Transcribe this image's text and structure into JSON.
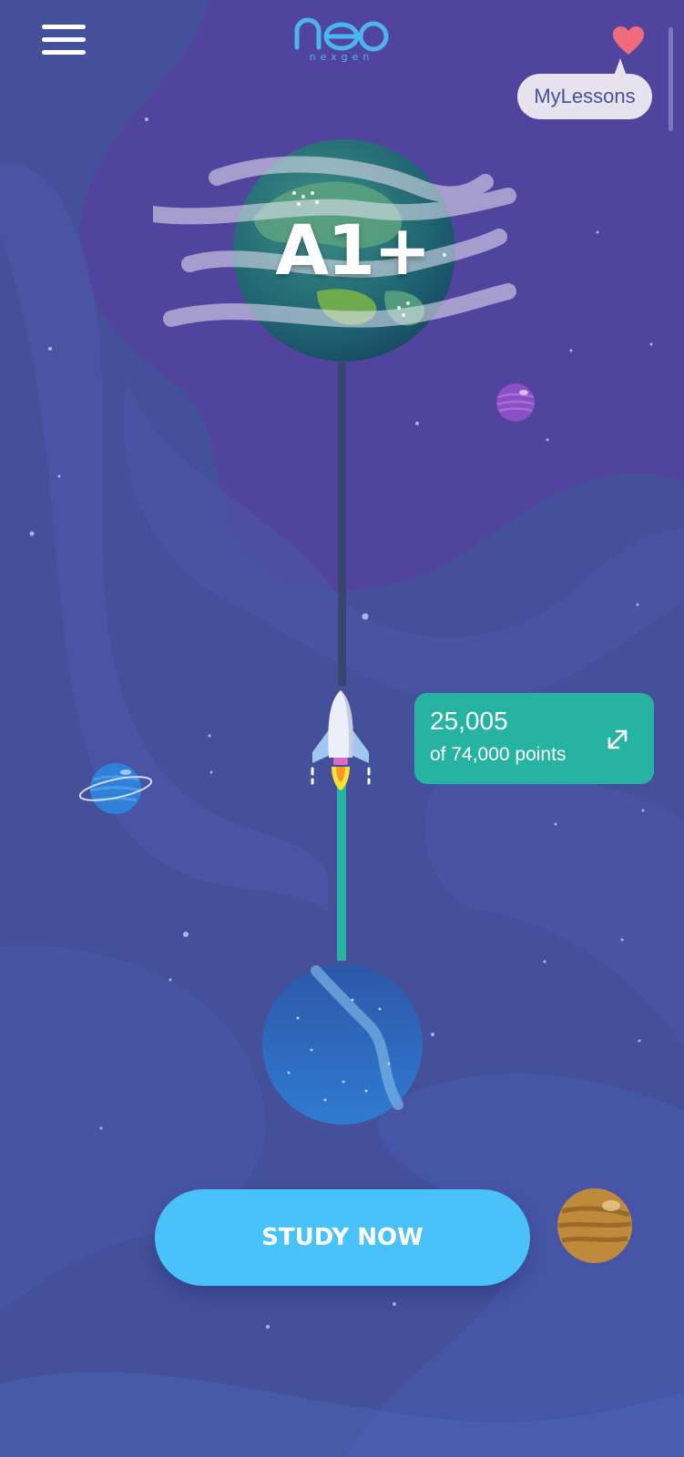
{
  "header": {
    "logo_text": "neo",
    "logo_tagline": "nexgen",
    "menu_icon": "hamburger-menu-icon",
    "favorite_icon": "heart-icon",
    "favorite_color": "#f06b7b",
    "my_lessons_label": "MyLessons"
  },
  "journey": {
    "level_label": "A1+",
    "points_value": "25,005",
    "points_total_text": "of 74,000 points",
    "expand_icon": "expand-arrows-icon",
    "progress_fraction": 0.338
  },
  "actions": {
    "study_now_label": "STUDY NOW"
  },
  "colors": {
    "background": "#44509a",
    "accent_teal": "#26b3a2",
    "button_blue": "#49c2fa",
    "logo_blue": "#4db4f0",
    "track_dark": "#38456f"
  }
}
